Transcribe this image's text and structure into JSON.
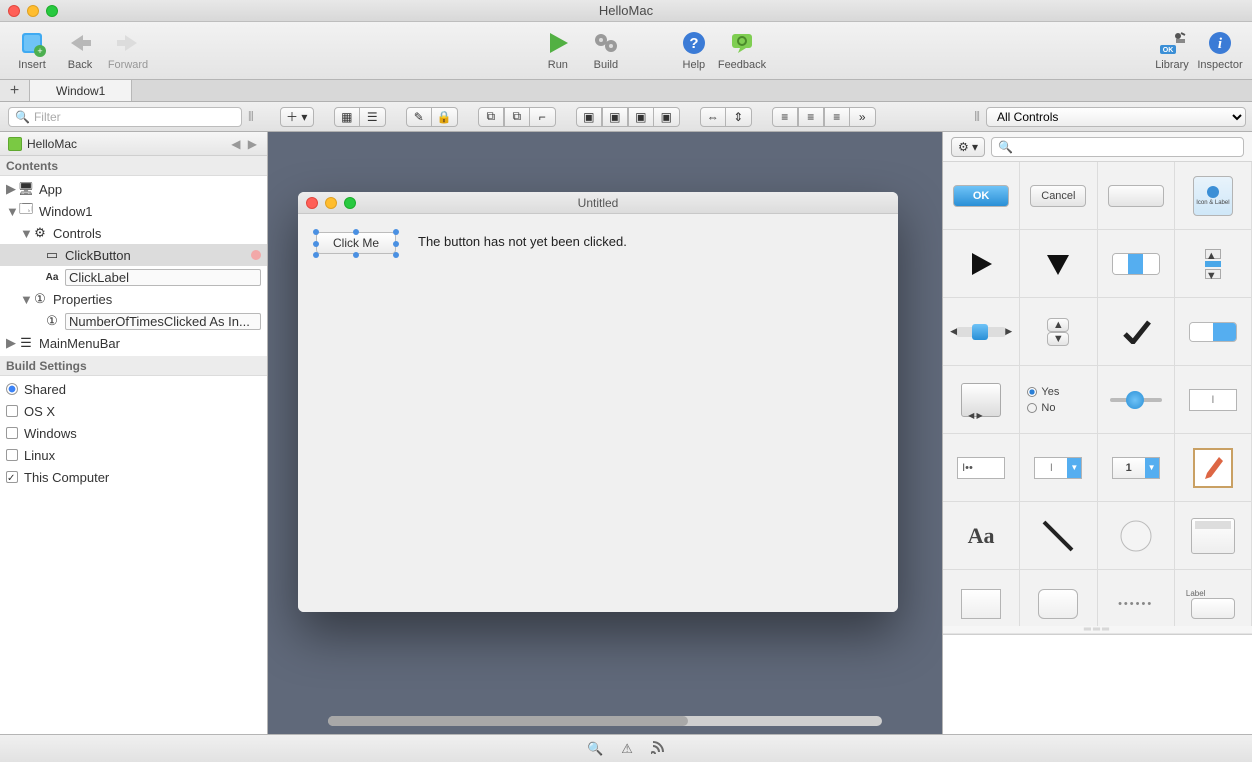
{
  "window": {
    "title": "HelloMac"
  },
  "toolbar": {
    "insert": "Insert",
    "back": "Back",
    "forward": "Forward",
    "run": "Run",
    "build": "Build",
    "help": "Help",
    "feedback": "Feedback",
    "library": "Library",
    "inspector": "Inspector"
  },
  "tabs": {
    "active": "Window1"
  },
  "filter": {
    "placeholder": "Filter"
  },
  "navigator": {
    "project": "HelloMac",
    "contents_label": "Contents",
    "items": {
      "app": "App",
      "window1": "Window1",
      "controls": "Controls",
      "clickbutton": "ClickButton",
      "clicklabel": "ClickLabel",
      "properties": "Properties",
      "prop0": "NumberOfTimesClicked As In...",
      "mainmenubar": "MainMenuBar"
    },
    "build_settings_label": "Build Settings",
    "build": {
      "shared": "Shared",
      "osx": "OS X",
      "windows": "Windows",
      "linux": "Linux",
      "this_computer": "This Computer"
    }
  },
  "designer": {
    "window_title": "Untitled",
    "button_label": "Click Me",
    "label_text": "The button has not yet been clicked."
  },
  "library": {
    "selector": "All Controls",
    "search_placeholder": "",
    "controls": {
      "ok": "OK",
      "cancel": "Cancel",
      "yes": "Yes",
      "no": "No",
      "aa": "Aa",
      "label": "Label",
      "one": "1",
      "iconlabel": "Icon & Label"
    }
  }
}
